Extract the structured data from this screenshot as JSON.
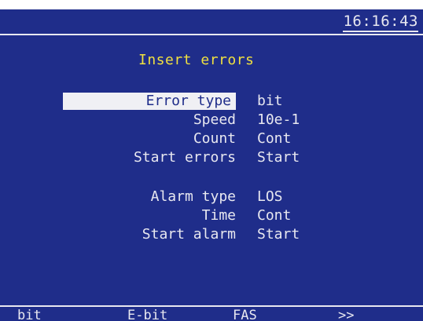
{
  "header": {
    "time": "16:16:43"
  },
  "panel": {
    "title": "Insert errors"
  },
  "error_settings": [
    {
      "label": "Error type",
      "value": "bit"
    },
    {
      "label": "Speed",
      "value": "10e-1"
    },
    {
      "label": "Count",
      "value": "Cont"
    },
    {
      "label": "Start errors",
      "value": "Start"
    }
  ],
  "alarm_settings": [
    {
      "label": "Alarm type",
      "value": "LOS"
    },
    {
      "label": "Time",
      "value": "Cont"
    },
    {
      "label": "Start alarm",
      "value": "Start"
    }
  ],
  "softkeys": [
    "bit",
    "E-bit",
    "FAS",
    ">>"
  ],
  "colors": {
    "background": "#1f2d8a",
    "text": "#e8e8f0",
    "title": "#f0e040",
    "highlight": "#f0f0f4"
  }
}
